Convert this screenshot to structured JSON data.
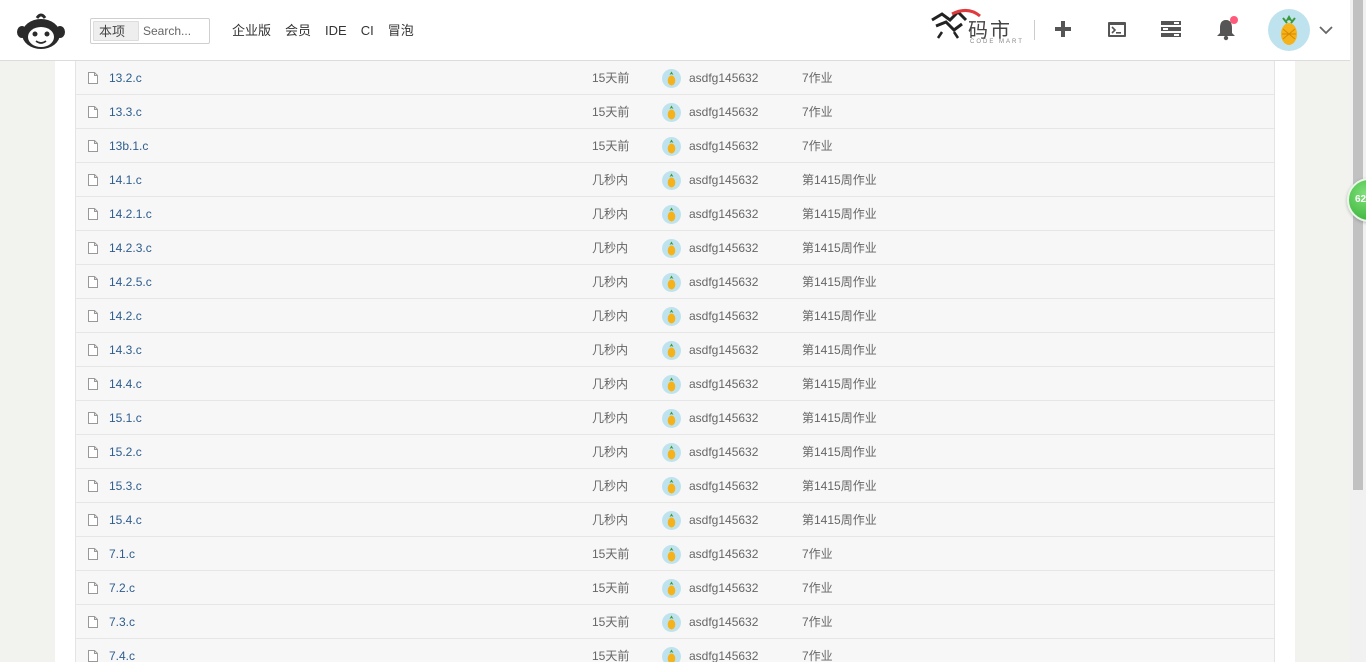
{
  "header": {
    "search_scope": "本项目",
    "search_placeholder": "Search...",
    "nav": [
      "企业版",
      "会员",
      "IDE",
      "CI",
      "冒泡"
    ],
    "mart_title": "码市",
    "mart_subtitle": "CODE MART"
  },
  "floating_badge": "62",
  "colors": {
    "link": "#2e5d8f",
    "notify": "#ff5a7a",
    "badge": "#2eaa2e"
  },
  "files": [
    {
      "name": "13.2.c",
      "time": "15天前",
      "author": "asdfg145632",
      "commit": "7作业"
    },
    {
      "name": "13.3.c",
      "time": "15天前",
      "author": "asdfg145632",
      "commit": "7作业"
    },
    {
      "name": "13b.1.c",
      "time": "15天前",
      "author": "asdfg145632",
      "commit": "7作业"
    },
    {
      "name": "14.1.c",
      "time": "几秒内",
      "author": "asdfg145632",
      "commit": "第1415周作业"
    },
    {
      "name": "14.2.1.c",
      "time": "几秒内",
      "author": "asdfg145632",
      "commit": "第1415周作业"
    },
    {
      "name": "14.2.3.c",
      "time": "几秒内",
      "author": "asdfg145632",
      "commit": "第1415周作业"
    },
    {
      "name": "14.2.5.c",
      "time": "几秒内",
      "author": "asdfg145632",
      "commit": "第1415周作业"
    },
    {
      "name": "14.2.c",
      "time": "几秒内",
      "author": "asdfg145632",
      "commit": "第1415周作业"
    },
    {
      "name": "14.3.c",
      "time": "几秒内",
      "author": "asdfg145632",
      "commit": "第1415周作业"
    },
    {
      "name": "14.4.c",
      "time": "几秒内",
      "author": "asdfg145632",
      "commit": "第1415周作业"
    },
    {
      "name": "15.1.c",
      "time": "几秒内",
      "author": "asdfg145632",
      "commit": "第1415周作业"
    },
    {
      "name": "15.2.c",
      "time": "几秒内",
      "author": "asdfg145632",
      "commit": "第1415周作业"
    },
    {
      "name": "15.3.c",
      "time": "几秒内",
      "author": "asdfg145632",
      "commit": "第1415周作业"
    },
    {
      "name": "15.4.c",
      "time": "几秒内",
      "author": "asdfg145632",
      "commit": "第1415周作业"
    },
    {
      "name": "7.1.c",
      "time": "15天前",
      "author": "asdfg145632",
      "commit": "7作业"
    },
    {
      "name": "7.2.c",
      "time": "15天前",
      "author": "asdfg145632",
      "commit": "7作业"
    },
    {
      "name": "7.3.c",
      "time": "15天前",
      "author": "asdfg145632",
      "commit": "7作业"
    },
    {
      "name": "7.4.c",
      "time": "15天前",
      "author": "asdfg145632",
      "commit": "7作业"
    }
  ]
}
